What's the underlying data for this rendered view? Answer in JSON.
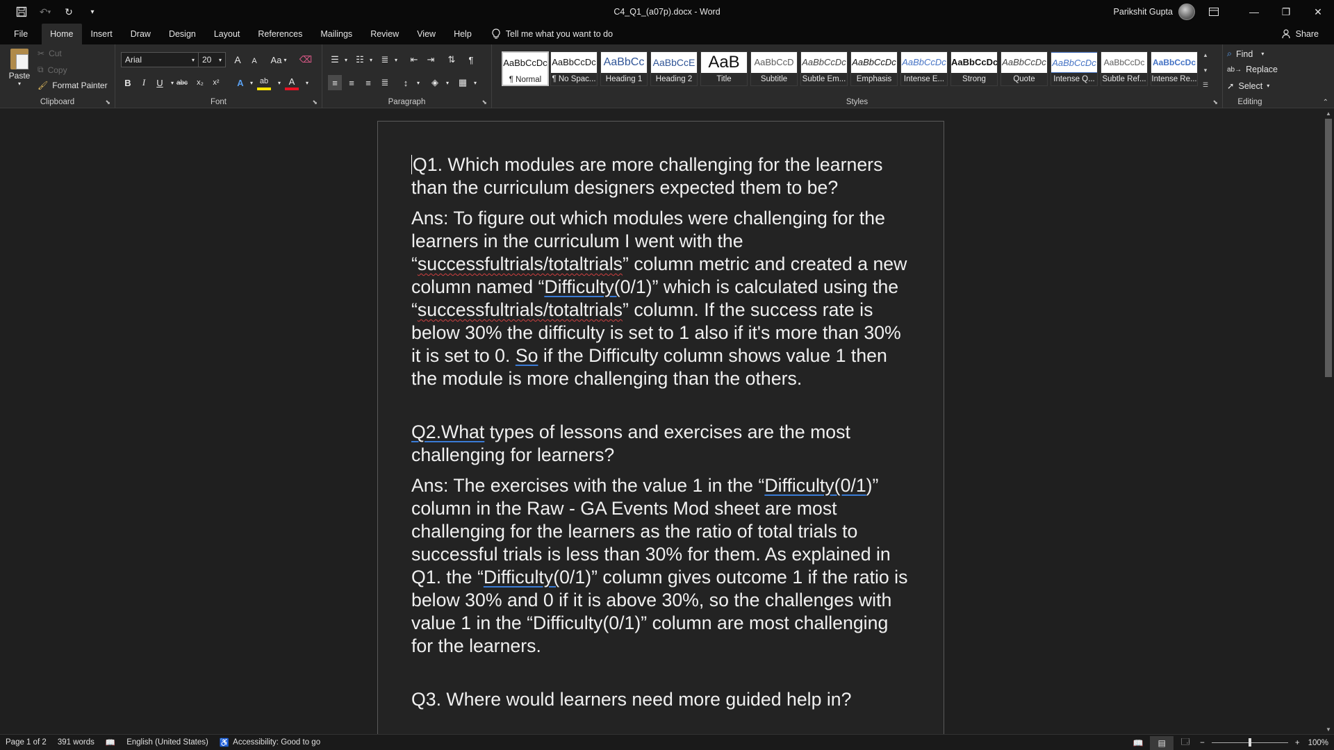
{
  "window": {
    "title": "C4_Q1_(a07p).docx  -  Word",
    "user_name": "Parikshit Gupta"
  },
  "tabs": [
    "File",
    "Home",
    "Insert",
    "Draw",
    "Design",
    "Layout",
    "References",
    "Mailings",
    "Review",
    "View",
    "Help"
  ],
  "active_tab": "Home",
  "tell_me": "Tell me what you want to do",
  "share": "Share",
  "clipboard": {
    "paste": "Paste",
    "cut": "Cut",
    "copy": "Copy",
    "format_painter": "Format Painter",
    "label": "Clipboard"
  },
  "font": {
    "name": "Arial",
    "size": "20",
    "change_case": "Aa",
    "label": "Font",
    "bold": "B",
    "italic": "I",
    "underline": "U",
    "strike": "abc",
    "subscript": "x₂",
    "superscript": "x²",
    "grow": "A",
    "shrink": "A",
    "effects": "A",
    "highlight": "ab",
    "font_color": "A"
  },
  "paragraph": {
    "label": "Paragraph"
  },
  "styles": {
    "label": "Styles",
    "items": [
      {
        "sample": "AaBbCcDc",
        "name": "¶ Normal"
      },
      {
        "sample": "AaBbCcDc",
        "name": "¶ No Spac..."
      },
      {
        "sample": "AaBbCc",
        "name": "Heading 1"
      },
      {
        "sample": "AaBbCcE",
        "name": "Heading 2"
      },
      {
        "sample": "AaB",
        "name": "Title"
      },
      {
        "sample": "AaBbCcD",
        "name": "Subtitle"
      },
      {
        "sample": "AaBbCcDc",
        "name": "Subtle Em..."
      },
      {
        "sample": "AaBbCcDc",
        "name": "Emphasis"
      },
      {
        "sample": "AaBbCcDc",
        "name": "Intense E..."
      },
      {
        "sample": "AaBbCcDc",
        "name": "Strong"
      },
      {
        "sample": "AaBbCcDc",
        "name": "Quote"
      },
      {
        "sample": "AaBbCcDc",
        "name": "Intense Q..."
      },
      {
        "sample": "AaBbCcDc",
        "name": "Subtle Ref..."
      },
      {
        "sample": "AaBbCcDc",
        "name": "Intense Re..."
      }
    ]
  },
  "editing": {
    "label": "Editing",
    "find": "Find",
    "replace": "Replace",
    "select": "Select"
  },
  "document": {
    "q1": "Q1. Which modules are more challenging for the learners than the curriculum designers expected them to be?",
    "a1_part1": "Ans: To figure out which modules were challenging for the learners in the curriculum I went with the “",
    "a1_sq1": "successfultrials/totaltrials",
    "a1_part2": "” column metric and created a new column named “",
    "a1_diff": "Difficulty(",
    "a1_part3": "0/1)” which is calculated using the “",
    "a1_sq2": "successfultrials/totaltrials",
    "a1_part4": "” column. If the success rate is below 30% the difficulty is set to 1 also if it's more than 30% it is set to 0. ",
    "a1_so": "So",
    "a1_part5": " if the Difficulty column shows value 1 then the module is more challenging than the others.",
    "q2_link": "Q2.What",
    "q2_rest": " types of lessons and exercises are the most challenging for learners?",
    "a2_part1": "Ans: The exercises with the value 1 in the “",
    "a2_diff1": "Difficulty(0/1",
    "a2_part2": ")” column in the Raw - GA Events Mod sheet are most challenging for the learners as the ratio of total trials to successful trials is less than 30% for them. As explained in Q1. the “",
    "a2_diff2": "Difficulty(",
    "a2_part3": "0/1)” column gives outcome 1 if the ratio is below 30% and 0 if it is above 30%, so the challenges with value 1 in the “Difficulty(0/1)” column are most challenging for the learners.",
    "q3": "Q3. Where would learners need more guided help in?"
  },
  "status": {
    "page": "Page 1 of 2",
    "words": "391 words",
    "language": "English (United States)",
    "accessibility": "Accessibility: Good to go",
    "zoom": "100%",
    "zoom_minus": "−",
    "zoom_plus": "+",
    "zoom_level": 0.5
  }
}
